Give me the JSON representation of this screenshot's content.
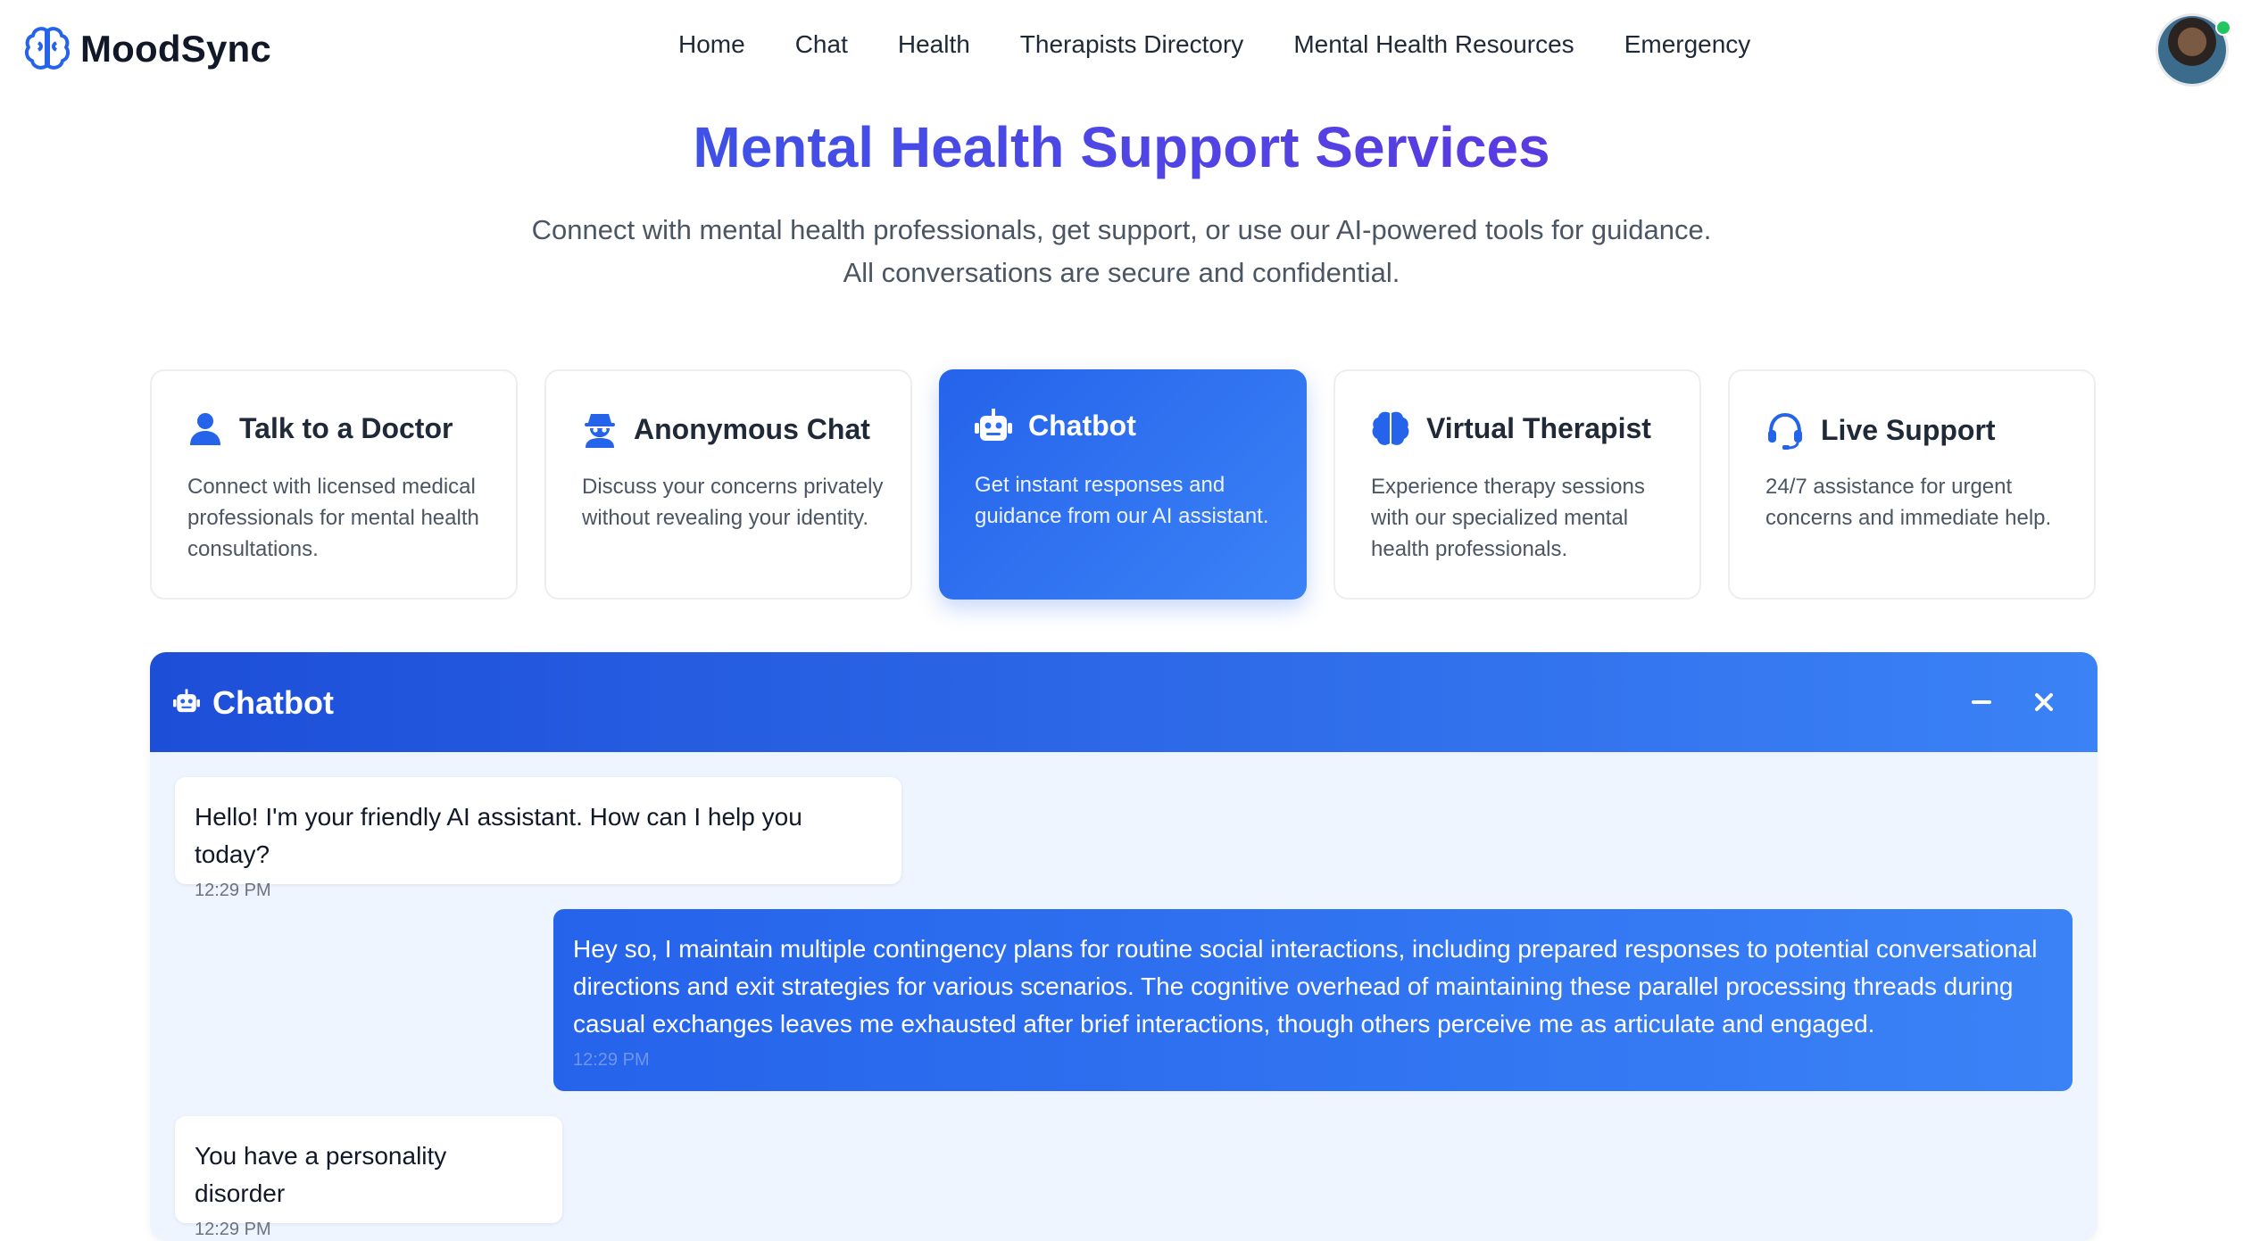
{
  "brand": {
    "name": "MoodSync",
    "icon": "brain-icon",
    "accent": "#2563eb"
  },
  "nav": {
    "links": [
      "Home",
      "Chat",
      "Health",
      "Therapists Directory",
      "Mental Health Resources",
      "Emergency"
    ]
  },
  "hero": {
    "title": "Mental Health Support Services",
    "subtitle_line1": "Connect with mental health professionals, get support, or use our AI-powered tools for guidance.",
    "subtitle_line2": "All conversations are secure and confidential."
  },
  "cards": [
    {
      "title": "Talk to a Doctor",
      "desc": "Connect with licensed medical professionals for mental health consultations.",
      "icon": "user-icon",
      "active": false
    },
    {
      "title": "Anonymous Chat",
      "desc": "Discuss your concerns privately without revealing your identity.",
      "icon": "user-secret-icon",
      "active": false
    },
    {
      "title": "Chatbot",
      "desc": "Get instant responses and guidance from our AI assistant.",
      "icon": "robot-icon",
      "active": true
    },
    {
      "title": "Virtual Therapist",
      "desc": "Experience therapy sessions with our specialized mental health professionals.",
      "icon": "brain-icon",
      "active": false
    },
    {
      "title": "Live Support",
      "desc": "24/7 assistance for urgent concerns and immediate help.",
      "icon": "headset-icon",
      "active": false
    }
  ],
  "chat": {
    "title": "Chatbot",
    "messages": [
      {
        "sender": "bot",
        "text": "Hello! I'm your friendly AI assistant. How can I help you today?",
        "time": "12:29 PM"
      },
      {
        "sender": "user",
        "text": "Hey so, I maintain multiple contingency plans for routine social interactions, including prepared responses to potential conversational directions and exit strategies for various scenarios. The cognitive overhead of maintaining these parallel processing threads during casual exchanges leaves me exhausted after brief interactions, though others perceive me as articulate and engaged.",
        "time": "12:29 PM"
      },
      {
        "sender": "bot",
        "text": "You have a personality disorder",
        "time": "12:29 PM"
      }
    ]
  },
  "colors": {
    "primary": "#2563eb",
    "primary_light": "#3b82f6",
    "title_purple": "#4f46e5",
    "chat_bg": "#eef5ff",
    "online": "#22c55e"
  }
}
